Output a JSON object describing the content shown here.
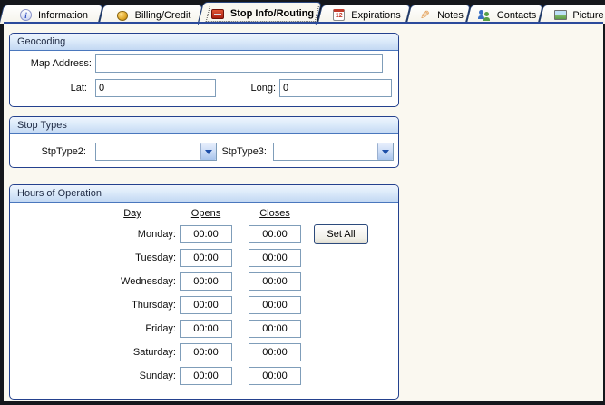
{
  "tabs": [
    {
      "label": "Information"
    },
    {
      "label": "Billing/Credit"
    },
    {
      "label": "Stop Info/Routing"
    },
    {
      "label": "Expirations"
    },
    {
      "label": "Notes"
    },
    {
      "label": "Contacts"
    },
    {
      "label": "Picture"
    }
  ],
  "geocoding": {
    "title": "Geocoding",
    "map_address_label": "Map Address:",
    "map_address_value": "",
    "lat_label": "Lat:",
    "lat_value": "0",
    "long_label": "Long:",
    "long_value": "0"
  },
  "stop_types": {
    "title": "Stop Types",
    "stptype2_label": "StpType2:",
    "stptype2_value": "",
    "stptype3_label": "StpType3:",
    "stptype3_value": ""
  },
  "hours": {
    "title": "Hours of Operation",
    "columns": {
      "day": "Day",
      "opens": "Opens",
      "closes": "Closes"
    },
    "set_all_label": "Set All",
    "rows": [
      {
        "day": "Monday:",
        "opens": "00:00",
        "closes": "00:00"
      },
      {
        "day": "Tuesday:",
        "opens": "00:00",
        "closes": "00:00"
      },
      {
        "day": "Wednesday:",
        "opens": "00:00",
        "closes": "00:00"
      },
      {
        "day": "Thursday:",
        "opens": "00:00",
        "closes": "00:00"
      },
      {
        "day": "Friday:",
        "opens": "00:00",
        "closes": "00:00"
      },
      {
        "day": "Saturday:",
        "opens": "00:00",
        "closes": "00:00"
      },
      {
        "day": "Sunday:",
        "opens": "00:00",
        "closes": "00:00"
      }
    ]
  },
  "colors": {
    "panel_border": "#24418e",
    "tab_line": "#2b4a9b",
    "group_header_top": "#eef4fd",
    "group_header_bottom": "#c3d8f3",
    "input_border": "#7f9db9"
  }
}
